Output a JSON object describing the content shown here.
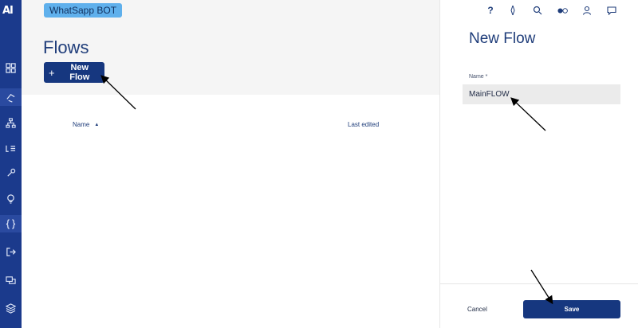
{
  "brand": {
    "logo_text": "AI"
  },
  "header": {
    "bot_name": "WhatSapp BOT",
    "page_title": "Flows",
    "new_flow_label": "New Flow",
    "new_flow_icon": "plus-icon"
  },
  "table": {
    "columns": [
      {
        "label": "Name",
        "sort": "ascending"
      },
      {
        "label": "Last edited"
      }
    ],
    "rows": []
  },
  "sidebar": {
    "items": [
      {
        "icon": "grid-icon",
        "active": false
      },
      {
        "icon": "flows-icon",
        "active": true
      },
      {
        "icon": "hierarchy-icon",
        "active": false
      },
      {
        "icon": "list-icon",
        "active": false
      },
      {
        "icon": "tools-icon",
        "active": false
      },
      {
        "icon": "lightbulb-icon",
        "active": false
      },
      {
        "icon": "code-braces-icon",
        "active": false
      },
      {
        "icon": "logout-icon",
        "active": false
      },
      {
        "icon": "chat-bubbles-icon",
        "active": false
      },
      {
        "icon": "layers-icon",
        "active": false
      }
    ]
  },
  "topbar_icons": [
    "help-icon",
    "compass-icon",
    "search-icon",
    "toggle-icon",
    "user-icon",
    "message-icon"
  ],
  "panel": {
    "title": "New Flow",
    "name_label": "Name *",
    "name_value": "MainFLOW",
    "cancel_label": "Cancel",
    "save_label": "Save"
  },
  "colors": {
    "rail": "#1b3a8c",
    "primary_button": "#16377f",
    "badge": "#5fb0ec",
    "header_bg": "#f5f5f5"
  }
}
